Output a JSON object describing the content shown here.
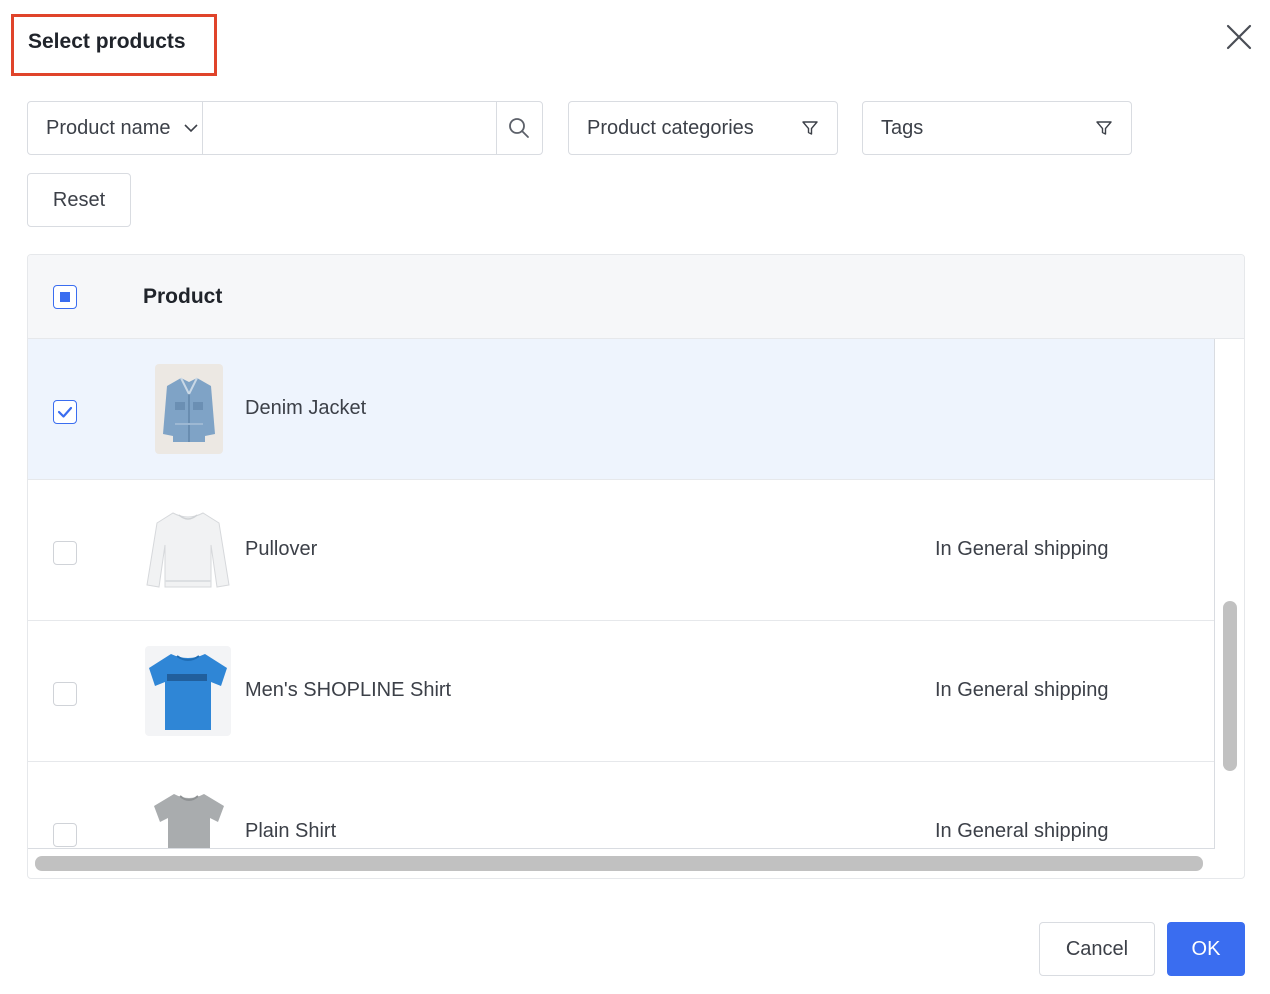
{
  "dialog": {
    "title": "Select products"
  },
  "filters": {
    "field_select": "Product name",
    "search_value": "",
    "categories": "Product categories",
    "tags": "Tags",
    "reset": "Reset"
  },
  "table": {
    "header": {
      "product": "Product"
    },
    "rows": [
      {
        "name": "Denim Jacket",
        "shipping": "",
        "checked": true
      },
      {
        "name": "Pullover",
        "shipping": "In General shipping",
        "checked": false
      },
      {
        "name": "Men's SHOPLINE Shirt",
        "shipping": "In General shipping",
        "checked": false
      },
      {
        "name": "Plain Shirt",
        "shipping": "In General shipping",
        "checked": false
      }
    ]
  },
  "footer": {
    "cancel": "Cancel",
    "ok": "OK"
  },
  "colors": {
    "accent": "#3a6df0",
    "highlight": "#e0442a",
    "selected_row": "#eef4fd"
  }
}
